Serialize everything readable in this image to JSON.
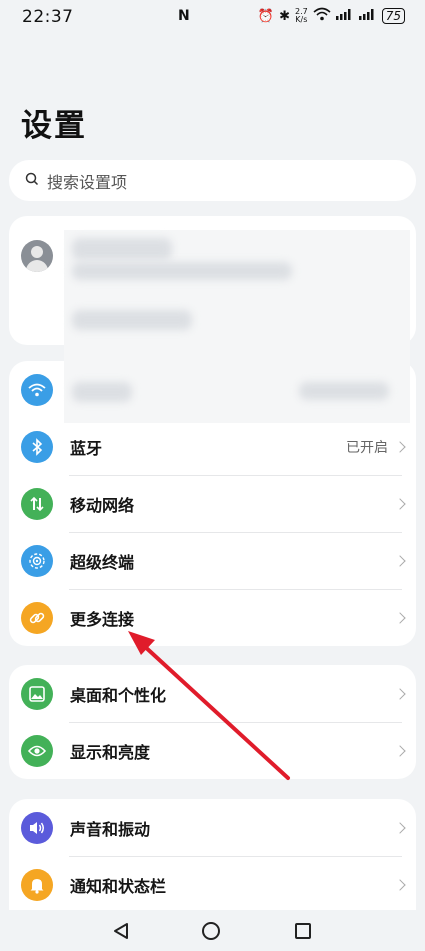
{
  "status_bar": {
    "time": "22:37",
    "speed_top": "2.7",
    "speed_bottom": "K/s",
    "battery": "75"
  },
  "page_title": "设置",
  "search": {
    "placeholder": "搜索设置项"
  },
  "groups": [
    {
      "items": [
        {
          "icon": "wifi-icon",
          "label": "",
          "value": "",
          "color": "#3a9ee6"
        },
        {
          "icon": "bluetooth-icon",
          "label": "蓝牙",
          "value": "已开启",
          "color": "#3a9ee6"
        },
        {
          "icon": "mobile-network-icon",
          "label": "移动网络",
          "value": "",
          "color": "#43b158"
        },
        {
          "icon": "super-device-icon",
          "label": "超级终端",
          "value": "",
          "color": "#3a9ee6"
        },
        {
          "icon": "link-icon",
          "label": "更多连接",
          "value": "",
          "color": "#f5a623"
        }
      ]
    },
    {
      "items": [
        {
          "icon": "wallpaper-icon",
          "label": "桌面和个性化",
          "color": "#43b158"
        },
        {
          "icon": "eye-icon",
          "label": "显示和亮度",
          "color": "#43b158"
        }
      ]
    },
    {
      "items": [
        {
          "icon": "speaker-icon",
          "label": "声音和振动",
          "color": "#5b5bdb"
        },
        {
          "icon": "bell-icon",
          "label": "通知和状态栏",
          "color": "#f5a623"
        }
      ]
    }
  ],
  "annotation": {
    "color": "#e01c2b"
  }
}
